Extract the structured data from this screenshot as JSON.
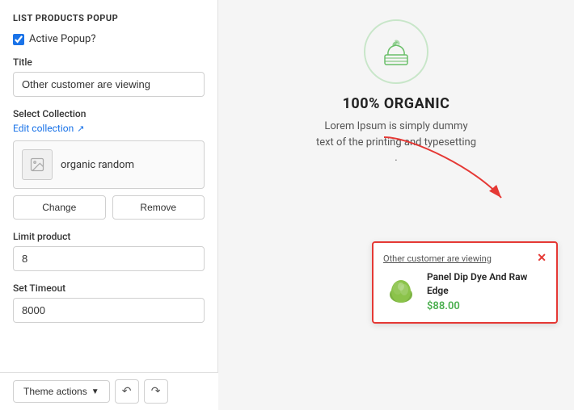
{
  "left_panel": {
    "section_title": "LIST PRODUCTS POPUP",
    "active_popup_label": "Active Popup?",
    "active_popup_checked": true,
    "title_label": "Title",
    "title_value": "Other customer are viewing",
    "select_collection_label": "Select Collection",
    "edit_collection_label": "Edit collection",
    "collection_name": "organic random",
    "change_btn": "Change",
    "remove_btn": "Remove",
    "limit_product_label": "Limit product",
    "limit_product_value": "8",
    "set_timeout_label": "Set Timeout",
    "set_timeout_value": "8000",
    "theme_actions_label": "Theme actions"
  },
  "right_panel": {
    "organic_title": "100% ORGANIC",
    "organic_desc": "Lorem Ipsum is simply dummy text of the printing and typesetting .",
    "popup": {
      "viewing_text": "Other customer are viewing",
      "product_name": "Panel Dip Dye And Raw Edge",
      "product_price": "$88.00"
    }
  }
}
